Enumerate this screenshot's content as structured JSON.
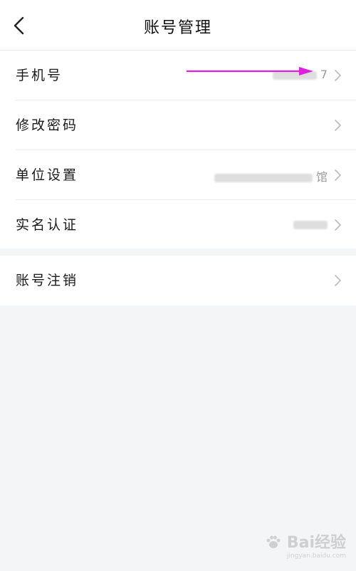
{
  "header": {
    "title": "账号管理",
    "back_icon": "chevron-left-icon"
  },
  "settings": [
    {
      "label": "手机号",
      "value_visible": "7"
    },
    {
      "label": "修改密码",
      "value_visible": ""
    },
    {
      "label": "单位设置",
      "value_visible": "馆"
    },
    {
      "label": "实名认证",
      "value_visible": ""
    }
  ],
  "account_cancel": {
    "label": "账号注销"
  },
  "annotation": {
    "color": "#e020e0"
  },
  "watermark": {
    "text": "Bai经验",
    "sub": "jingyan.baidu.com"
  },
  "colors": {
    "background": "#f4f5f7",
    "panel": "#ffffff",
    "chevron": "#bdbdbd"
  }
}
